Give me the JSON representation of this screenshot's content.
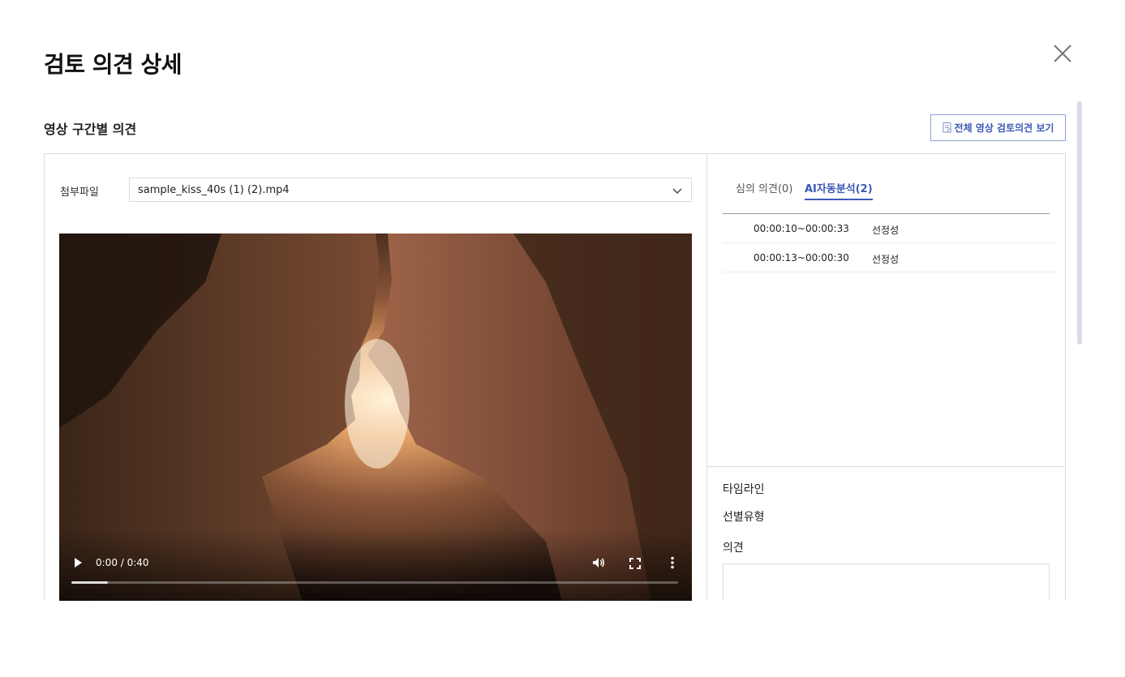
{
  "modal": {
    "title": "검토 의견 상세"
  },
  "section": {
    "title": "영상 구간별 의견",
    "view_all_label": "전체 영상 검토의견 보기"
  },
  "attachment": {
    "label": "첨부파일",
    "selected_file": "sample_kiss_40s (1) (2).mp4"
  },
  "video": {
    "time": "0:00 / 0:40",
    "progress_fraction": 0.06
  },
  "tabs": [
    {
      "label": "심의 의견(0)",
      "active": false
    },
    {
      "label": "AI자동분석(2)",
      "active": true
    }
  ],
  "segments": [
    {
      "range": "00:00:10~00:00:33",
      "author": "선정성"
    },
    {
      "range": "00:00:13~00:00:30",
      "author": "선정성"
    }
  ],
  "details": {
    "timeline_label": "타임라인",
    "type_label": "선별유형",
    "opinion_label": "의견"
  },
  "colors": {
    "accent": "#3c5ab5",
    "border": "#dcdcdc"
  },
  "icons": [
    "close-icon",
    "document-icon",
    "chevron-down-icon",
    "play-icon",
    "volume-icon",
    "fullscreen-icon",
    "more-vertical-icon"
  ]
}
